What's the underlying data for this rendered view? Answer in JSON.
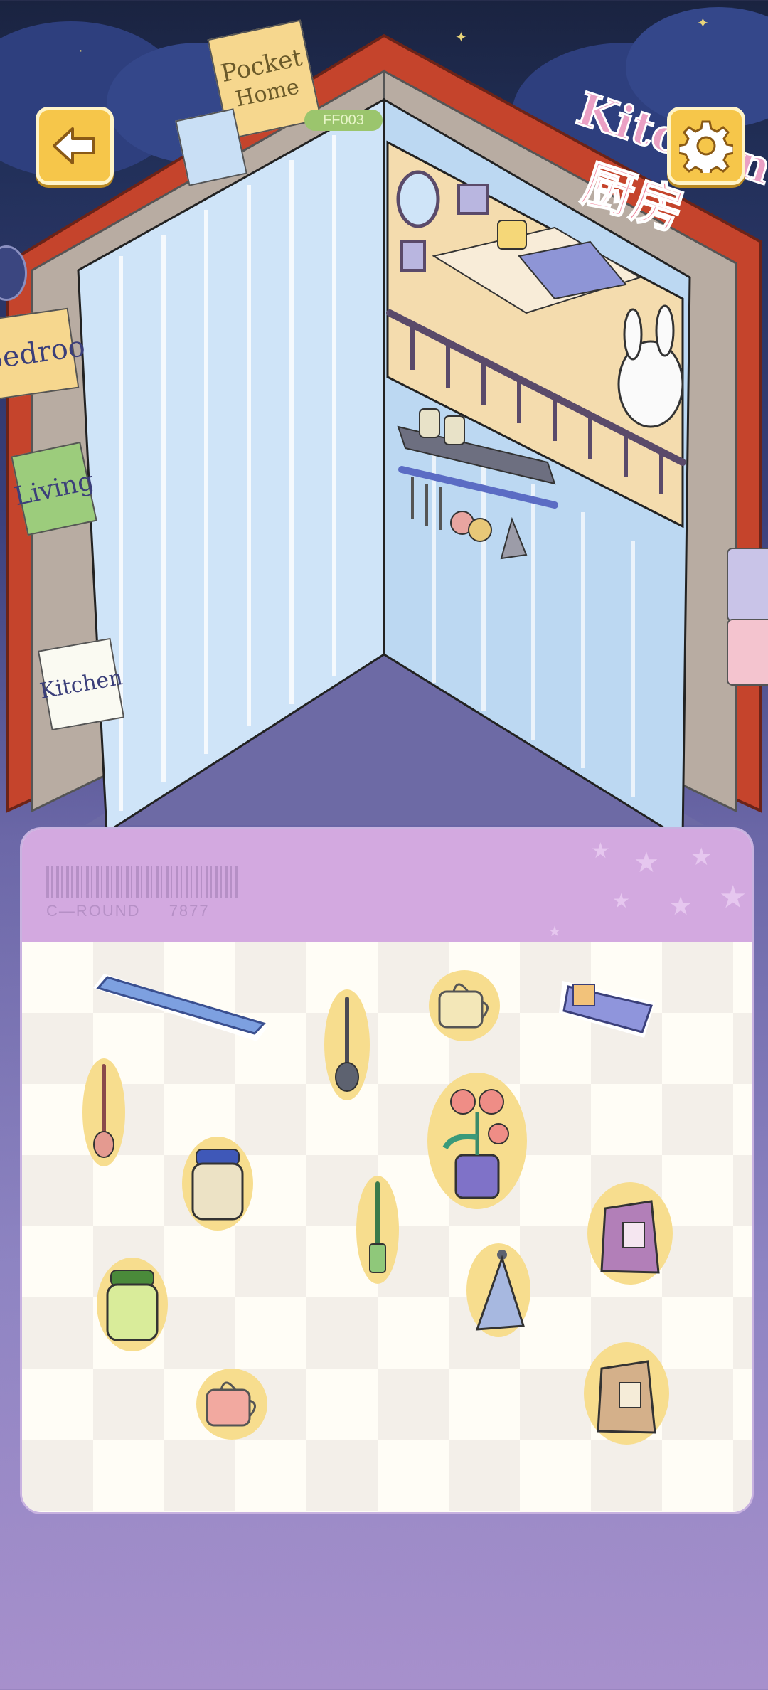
{
  "game": {
    "signs": {
      "pocket_home_line1": "Pocket",
      "pocket_home_line2": "Home",
      "kitchen_en": "Kitchen",
      "kitchen_cn": "厨房",
      "bedroom": "Bedroo",
      "living": "Living",
      "kitchen_page": "Kitchen"
    },
    "badge": "FF003",
    "round_label": "C—ROUND",
    "round_number": "7877"
  },
  "colors": {
    "button_yellow": "#f6c64a",
    "panel_header": "#d3a9e0",
    "book_cover": "#c5442c",
    "wall_blue": "#cfe4f8",
    "floor": "#6d6aa5"
  },
  "icons": {
    "back": "arrow-left-icon",
    "settings": "gear-icon"
  },
  "inventory_items": [
    {
      "name": "blue-shelf-board"
    },
    {
      "name": "ladle-gray"
    },
    {
      "name": "mug-yellow"
    },
    {
      "name": "tea-package"
    },
    {
      "name": "spoon-red"
    },
    {
      "name": "flower-pot"
    },
    {
      "name": "jar-blue-lid"
    },
    {
      "name": "spatula-green"
    },
    {
      "name": "paper-bag-purple"
    },
    {
      "name": "jar-green-lid"
    },
    {
      "name": "towel-blue"
    },
    {
      "name": "mug-pink"
    },
    {
      "name": "paper-bag-tan"
    }
  ]
}
